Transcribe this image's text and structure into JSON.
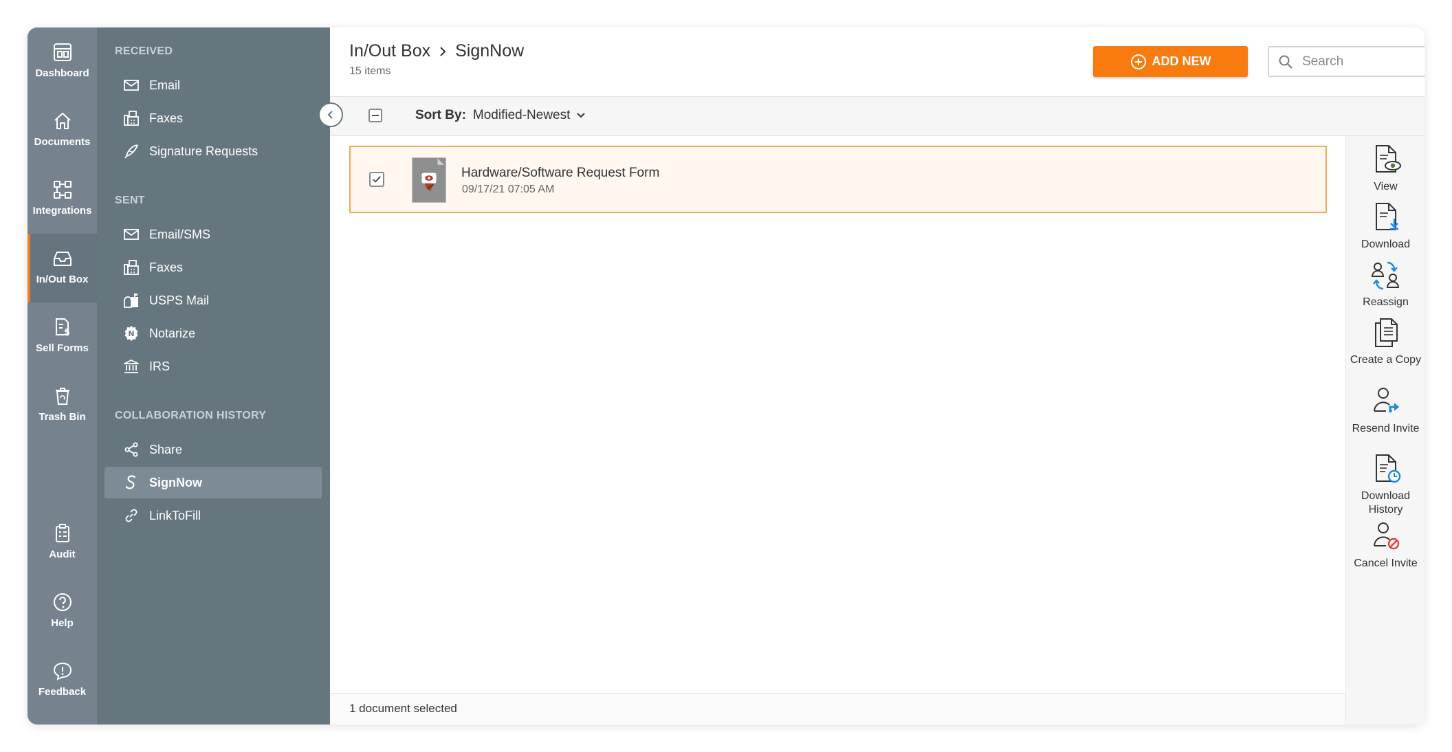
{
  "nav": {
    "items": [
      {
        "label": "Dashboard",
        "icon": "dashboard-icon"
      },
      {
        "label": "Documents",
        "icon": "home-icon"
      },
      {
        "label": "Integrations",
        "icon": "integrations-icon"
      },
      {
        "label": "In/Out Box",
        "icon": "inbox-icon",
        "active": true
      },
      {
        "label": "Sell Forms",
        "icon": "sell-forms-icon"
      },
      {
        "label": "Trash Bin",
        "icon": "trash-icon"
      },
      {
        "label": "Audit",
        "icon": "audit-icon"
      },
      {
        "label": "Help",
        "icon": "help-icon"
      },
      {
        "label": "Feedback",
        "icon": "feedback-icon"
      }
    ]
  },
  "folders": {
    "received_heading": "RECEIVED",
    "received": [
      "Email",
      "Faxes",
      "Signature Requests"
    ],
    "sent_heading": "SENT",
    "sent": [
      "Email/SMS",
      "Faxes",
      "USPS Mail",
      "Notarize",
      "IRS"
    ],
    "collab_heading": "COLLABORATION HISTORY",
    "collab": [
      "Share",
      "SignNow",
      "LinkToFill"
    ],
    "active": "SignNow"
  },
  "header": {
    "breadcrumb_root": "In/Out Box",
    "breadcrumb_current": "SignNow",
    "item_count": "15 items",
    "add_new_label": "ADD NEW",
    "search_placeholder": "Search"
  },
  "toolbar": {
    "sort_label": "Sort By:",
    "sort_value": "Modified-Newest"
  },
  "documents": [
    {
      "name": "Hardware/Software Request Form",
      "date": "09/17/21 07:05 AM",
      "selected": true
    }
  ],
  "footer": {
    "status": "1 document selected"
  },
  "actions": [
    {
      "label": "View"
    },
    {
      "label": "Download"
    },
    {
      "label": "Reassign"
    },
    {
      "label": "Create a Copy"
    },
    {
      "label": "Resend Invite"
    },
    {
      "label": "Download History"
    },
    {
      "label": "Cancel Invite"
    }
  ],
  "colors": {
    "accent": "#f77b0e",
    "rail": "#76838f",
    "panel": "#66767f",
    "selected_border": "#f7a74e",
    "selected_bg": "#fff7f0"
  }
}
